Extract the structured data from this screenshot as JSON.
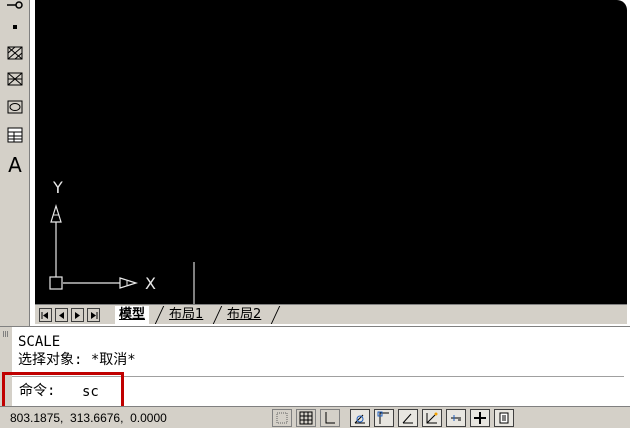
{
  "toolbar": {
    "icons": [
      "key-icon",
      "point-icon",
      "hatch-icon",
      "gradient-icon",
      "region-icon",
      "table-icon",
      "multiline-text-icon"
    ],
    "text_button_label": "A"
  },
  "canvas": {
    "background": "#000000",
    "ucs": {
      "x_label": "X",
      "y_label": "Y"
    }
  },
  "layout_tabs": {
    "tabs": [
      {
        "label": "模型",
        "active": true
      },
      {
        "label": "布局1",
        "active": false
      },
      {
        "label": "布局2",
        "active": false
      }
    ]
  },
  "command_window": {
    "history": [
      "SCALE",
      "选择对象: *取消*"
    ],
    "prompt_label": "命令: ",
    "input_value": "sc",
    "highlight_color": "#c00000"
  },
  "status_bar": {
    "coordinates": "803.1875,  313.6676,  0.0000",
    "buttons": [
      {
        "name": "snap-button",
        "on": false
      },
      {
        "name": "grid-button",
        "on": false
      },
      {
        "name": "ortho-button",
        "on": false
      },
      {
        "name": "polar-button",
        "on": true
      },
      {
        "name": "osnap-button",
        "on": true
      },
      {
        "name": "otrack-button",
        "on": true
      },
      {
        "name": "ducs-button",
        "on": true
      },
      {
        "name": "dyn-button",
        "on": true
      },
      {
        "name": "lineweight-button",
        "on": true
      },
      {
        "name": "quick-properties-button",
        "on": true
      }
    ]
  }
}
